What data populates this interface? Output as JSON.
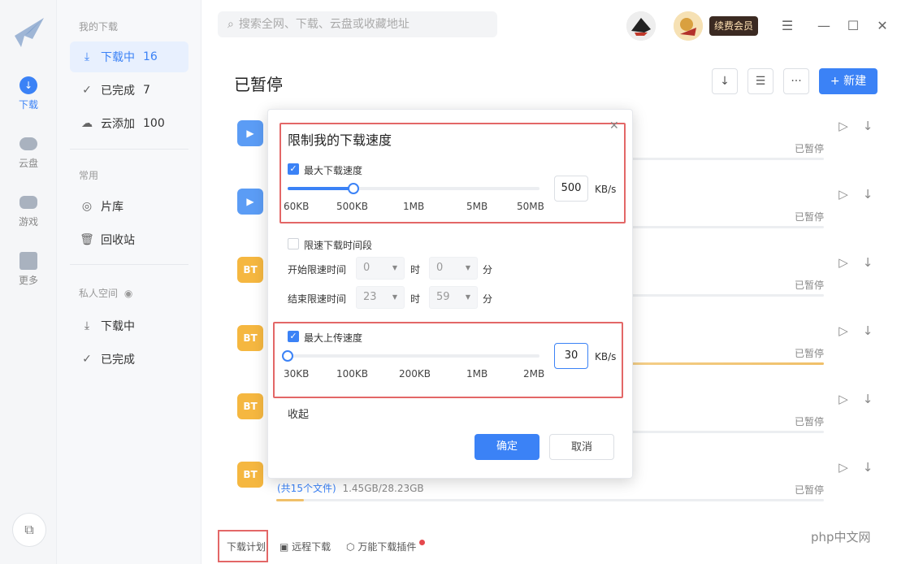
{
  "rail": {
    "items": [
      {
        "label": "下载",
        "icon": "download-icon"
      },
      {
        "label": "云盘",
        "icon": "cloud-icon"
      },
      {
        "label": "游戏",
        "icon": "gamepad-icon"
      },
      {
        "label": "更多",
        "icon": "grid-icon"
      }
    ]
  },
  "sidebar": {
    "section_mine": "我的下载",
    "downloading": {
      "label": "下载中",
      "count": "16"
    },
    "completed": {
      "label": "已完成",
      "count": "7"
    },
    "cloud_add": {
      "label": "云添加",
      "count": "100"
    },
    "section_common": "常用",
    "library": "片库",
    "recycle": "回收站",
    "section_private": "私人空间",
    "private_downloading": "下载中",
    "private_completed": "已完成"
  },
  "search": {
    "placeholder": "搜索全网、下载、云盘或收藏地址"
  },
  "header": {
    "vip_label": "续费会员"
  },
  "main": {
    "title": "已暂停",
    "new_label": "新建",
    "rows": [
      {
        "status": "已暂停",
        "icon_text": "",
        "progress": 0
      },
      {
        "status": "已暂停",
        "icon_text": "",
        "progress": 0
      },
      {
        "status": "已暂停",
        "icon_text": "BT",
        "progress": 0
      },
      {
        "status": "已暂停",
        "icon_text": "BT",
        "progress": 0.62
      },
      {
        "status": "已暂停",
        "icon_text": "BT",
        "progress": 0
      },
      {
        "status": "已暂停",
        "icon_text": "BT",
        "progress": 0.05,
        "meta_files": "(共15个文件)",
        "meta_size": "1.45GB/28.23GB"
      }
    ]
  },
  "dialog": {
    "title": "限制我的下载速度",
    "max_download_label": "最大下载速度",
    "download_value": "500",
    "download_unit": "KB/s",
    "download_ticks": [
      "60KB",
      "500KB",
      "1MB",
      "5MB",
      "50MB"
    ],
    "download_level": 0.26,
    "limit_period_label": "限速下载时间段",
    "start_label": "开始限速时间",
    "end_label": "结束限速时间",
    "hour_unit": "时",
    "minute_unit": "分",
    "start_hour": "0",
    "start_minute": "0",
    "end_hour": "23",
    "end_minute": "59",
    "max_upload_label": "最大上传速度",
    "upload_value": "30",
    "upload_unit": "KB/s",
    "upload_ticks": [
      "30KB",
      "100KB",
      "200KB",
      "1MB",
      "2MB"
    ],
    "upload_level": 0,
    "collapse_label": "收起",
    "ok_label": "确定",
    "cancel_label": "取消"
  },
  "bottom": {
    "schedule_label": "下载计划",
    "remote_label": "远程下载",
    "plugin_label": "万能下载插件"
  },
  "watermark": "php中文网"
}
